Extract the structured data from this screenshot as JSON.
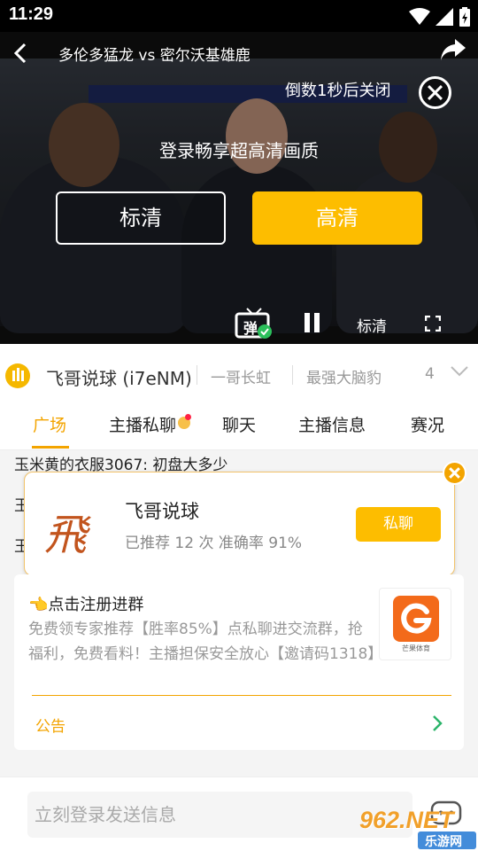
{
  "status_bar": {
    "time": "11:29"
  },
  "video": {
    "title": "多伦多猛龙 vs 密尔沃基雄鹿",
    "countdown": "倒数1秒后关闭",
    "login_hint": "登录畅享超高清画质",
    "btn_sd": "标清",
    "btn_hd": "高清",
    "danmu_label": "弹",
    "quality_label": "标清"
  },
  "anchor_row": {
    "name": "飞哥说球 (i7eNM)",
    "other1": "一哥长虹",
    "other2": "最强大脑豹",
    "count": "4"
  },
  "tabs": [
    {
      "label": "广场",
      "active": true
    },
    {
      "label": "主播私聊",
      "active": false
    },
    {
      "label": "聊天",
      "active": false
    },
    {
      "label": "主播信息",
      "active": false
    },
    {
      "label": "赛况",
      "active": false
    }
  ],
  "chat": {
    "messages": [
      "玉米黄的衣服3067: 初盘大多少",
      "玉",
      "玉"
    ]
  },
  "popup": {
    "logo_char": "飛",
    "name": "飞哥说球",
    "stats": "已推荐 12 次 准确率 91%",
    "button": "私聊"
  },
  "notice": {
    "title": "👈点击注册进群",
    "body": "免费领专家推荐【胜率85%】点私聊进交流群，抢福利，免费看料！主播担保安全放心【邀请码1318】",
    "logo_caption": "芒果体育",
    "label": "公告"
  },
  "input": {
    "placeholder": "立刻登录发送信息"
  },
  "watermark": {
    "brand": "962.NET",
    "sub": "乐游网"
  },
  "colors": {
    "accent": "#f3a400",
    "button_yellow": "#fdbd00",
    "black": "#000000"
  },
  "icons": [
    "back-icon",
    "share-icon",
    "close-icon",
    "danmu-icon",
    "pause-icon",
    "fullscreen-icon",
    "anchor-badge-icon",
    "chevron-down-icon",
    "chevron-right-icon",
    "chat-robot-icon"
  ]
}
